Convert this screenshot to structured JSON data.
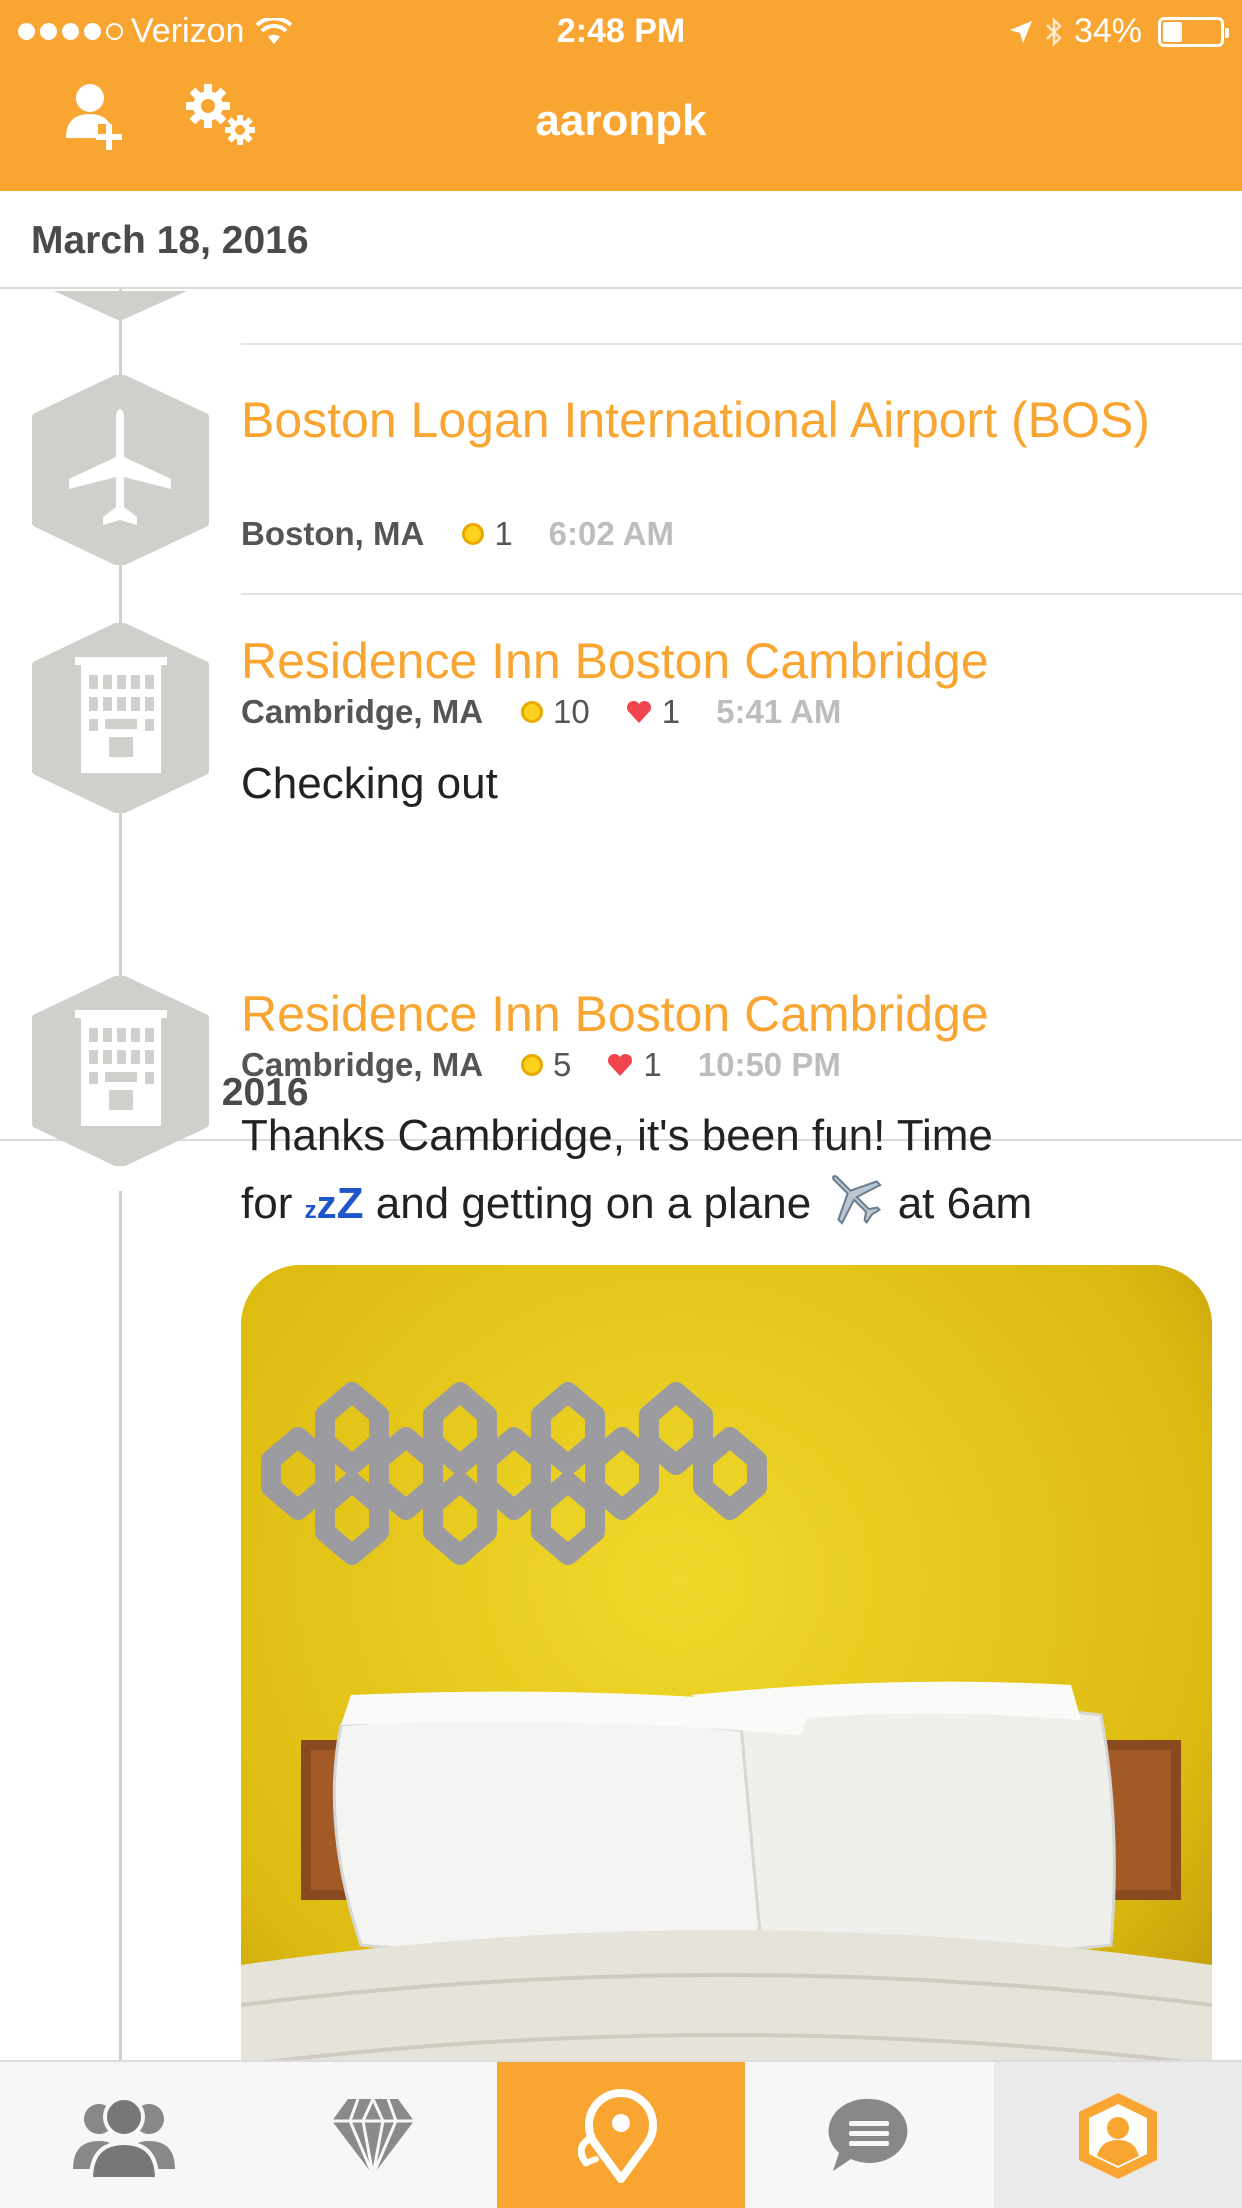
{
  "status_bar": {
    "carrier": "Verizon",
    "time": "2:48 PM",
    "battery": "34%",
    "battery_level": 0.34
  },
  "header": {
    "title": "aaronpk",
    "left_icons": [
      "add-friend-icon",
      "settings-icon"
    ]
  },
  "colors": {
    "brand": "#F9A531",
    "coin": "#FCD21C",
    "heart": "#F0454F",
    "timeline": "#D0CFCB"
  },
  "feed": {
    "sections": [
      {
        "date": "March 18, 2016",
        "checkins": [
          {
            "icon": "airplane-icon",
            "venue": "Boston Logan International Airport (BOS)",
            "location": "Boston, MA",
            "coins": "1",
            "time": "6:02 AM"
          },
          {
            "icon": "hotel-icon",
            "venue": "Residence Inn Boston Cambridge",
            "location": "Cambridge, MA",
            "coins": "10",
            "likes": "1",
            "time": "5:41 AM",
            "shout": "Checking out"
          }
        ]
      },
      {
        "date": "March 17, 2016",
        "checkins": [
          {
            "icon": "hotel-icon",
            "venue": "Residence Inn Boston Cambridge",
            "location": "Cambridge, MA",
            "coins": "5",
            "likes": "1",
            "time": "10:50 PM",
            "shout_line1": "Thanks Cambridge, it's been fun! Time",
            "shout_line2_a": "for",
            "shout_line2_b": "and getting on a plane",
            "shout_line2_c": "at 6am",
            "has_photo": true
          }
        ]
      }
    ]
  },
  "tabbar": {
    "tabs": [
      "friends-icon",
      "gem-icon",
      "checkin-icon",
      "chat-icon",
      "profile-icon"
    ],
    "active": "checkin-icon"
  }
}
